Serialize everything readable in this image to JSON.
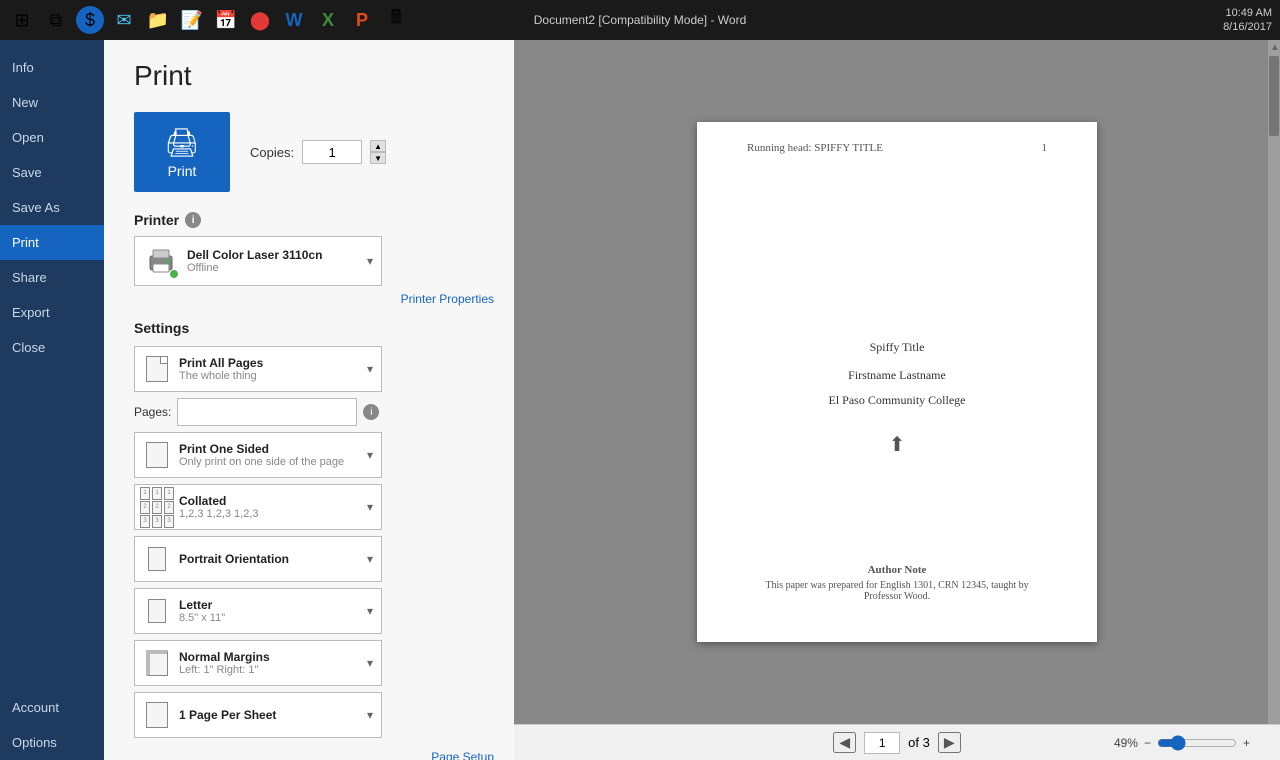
{
  "taskbar": {
    "title": "Document2 [Compatibility Mode] - Word",
    "time": "10:49 AM",
    "date": "8/16/2017"
  },
  "nav": {
    "items": [
      {
        "id": "info",
        "label": "Info"
      },
      {
        "id": "new",
        "label": "New"
      },
      {
        "id": "open",
        "label": "Open"
      },
      {
        "id": "save",
        "label": "Save"
      },
      {
        "id": "save-as",
        "label": "Save As"
      },
      {
        "id": "print",
        "label": "Print",
        "active": true
      },
      {
        "id": "share",
        "label": "Share"
      },
      {
        "id": "export",
        "label": "Export"
      },
      {
        "id": "close",
        "label": "Close"
      },
      {
        "id": "account",
        "label": "Account"
      },
      {
        "id": "options",
        "label": "Options"
      }
    ]
  },
  "print": {
    "title": "Print",
    "button_label": "Print",
    "copies_label": "Copies:",
    "copies_value": "1"
  },
  "printer": {
    "section_title": "Printer",
    "name": "Dell Color Laser 3110cn",
    "status": "Offline",
    "properties_link": "Printer Properties"
  },
  "settings": {
    "section_title": "Settings",
    "options": [
      {
        "id": "print-all-pages",
        "main": "Print All Pages",
        "sub": "The whole thing"
      },
      {
        "id": "pages-label",
        "label": "Pages:"
      },
      {
        "id": "print-one-sided",
        "main": "Print One Sided",
        "sub": "Only print on one side of the page"
      },
      {
        "id": "collated",
        "main": "Collated",
        "sub": "1,2,3   1,2,3   1,2,3"
      },
      {
        "id": "portrait-orientation",
        "main": "Portrait Orientation",
        "sub": ""
      },
      {
        "id": "letter",
        "main": "Letter",
        "sub": "8.5\" x 11\""
      },
      {
        "id": "normal-margins",
        "main": "Normal Margins",
        "sub": "Left: 1\"   Right: 1\""
      },
      {
        "id": "page-per-sheet",
        "main": "1 Page Per Sheet",
        "sub": ""
      }
    ],
    "page_setup_link": "Page Setup"
  },
  "document": {
    "running_head": "Running head: SPIFFY TITLE",
    "page_number": "1",
    "title": "Spiffy Title",
    "author": "Firstname Lastname",
    "institution": "El Paso Community College",
    "author_note_title": "Author Note",
    "author_note_text": "This paper was prepared for English 1301, CRN 12345, taught by Professor Wood."
  },
  "preview_nav": {
    "current_page": "1",
    "of_text": "of 3",
    "zoom_text": "49%"
  },
  "colors": {
    "nav_active": "#1565c0",
    "nav_bg": "#1e3a5f",
    "print_btn": "#1565c0"
  }
}
